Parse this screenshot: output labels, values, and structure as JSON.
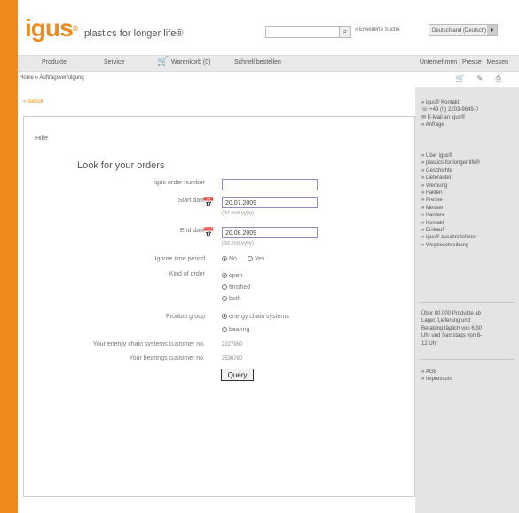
{
  "header": {
    "logo": "igus",
    "logo_mark": "®",
    "tagline": "plastics for longer life®",
    "search_button": "⌕",
    "advanced_search": "» Erweiterte Suche",
    "language": "Deutschland (Deutsch)"
  },
  "nav": {
    "items": [
      "Produkte",
      "Service",
      "Warenkorb (0)",
      "Schnell bestellen"
    ],
    "top_links": "Unternehmen  |  Presse  |  Messen"
  },
  "breadcrumb": "Home » Auftragsverfolgung",
  "tools": "🛒 ✎ ⎙",
  "back_link": "« zurück",
  "help_link": "Hilfe",
  "form": {
    "title": "Look for your orders",
    "igus_order_label": "igus order number",
    "igus_order_value": "",
    "start_label": "Start date",
    "start_value": "20.07.2009",
    "start_hint": "(dd.mm.yyyy)",
    "end_label": "End date",
    "end_value": "20.08.2009",
    "end_hint": "(dd.mm.yyyy)",
    "timeperiod_label": "Ignore time period",
    "timeperiod_options": [
      "No",
      "Yes"
    ],
    "order_kind_label": "Kind of order",
    "order_kind_options": [
      "open",
      "finished",
      "both"
    ],
    "product_group_label": "Product group",
    "product_group_options": [
      "energy chain systems",
      "bearing"
    ],
    "energy_number_label": "Your energy chain systems customer no.",
    "energy_number_value": "2227990",
    "bearing_number_label": "Your bearings customer no.",
    "bearing_number_value": "2536780",
    "query_button": "Query"
  },
  "sidebar": {
    "contact": [
      "» igus® Kontakt",
      "☏ +49 (0) 2203-9649-0",
      "✉ E-Mail an igus®",
      "» Anfrage"
    ],
    "links": [
      "» Über igus®",
      "» plastics for longer life®",
      "» Geschichte",
      "» Lieferanten",
      "» Werbung",
      "» Fakten",
      "» Presse",
      "» Messen",
      "» Karriere",
      "» Kontakt",
      "» Einkauf",
      "» igus® zuschnittsfreier",
      "» Wegbeschreibung"
    ],
    "info": [
      "Über 80.000 Produkte ab",
      "Lager, Lieferung und",
      "Beratung täglich von 6:30",
      "Uhr und Samstags von 8-",
      "12 Uhr"
    ],
    "footer_links": [
      "» AGB",
      "» Impressum"
    ]
  }
}
